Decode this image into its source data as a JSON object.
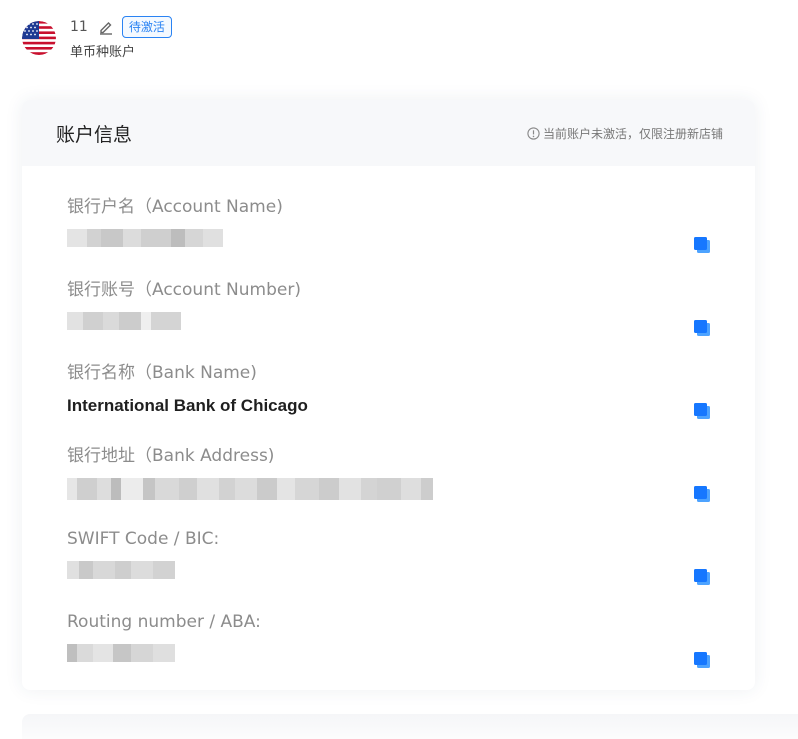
{
  "account": {
    "name": "11",
    "status": "待激活",
    "type": "单币种账户",
    "flag_icon": "us-flag-icon"
  },
  "card": {
    "title": "账户信息",
    "notice": "当前账户未激活，仅限注册新店铺"
  },
  "fields": [
    {
      "label": "银行户名（Account Name)",
      "value": "",
      "redacted": true
    },
    {
      "label": "银行账号（Account Number)",
      "value": "",
      "redacted": true
    },
    {
      "label": "银行名称（Bank Name)",
      "value": "International Bank of Chicago",
      "redacted": false
    },
    {
      "label": "银行地址（Bank Address)",
      "value": "",
      "redacted": true
    },
    {
      "label": "SWIFT Code / BIC:",
      "value": "",
      "redacted": true
    },
    {
      "label": "Routing number / ABA:",
      "value": "",
      "redacted": true
    }
  ],
  "colors": {
    "accent": "#1677ff",
    "badge": "#2a83f3"
  }
}
